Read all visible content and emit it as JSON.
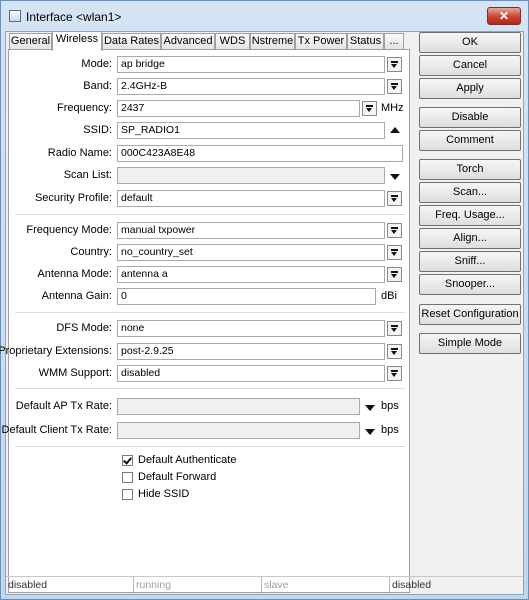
{
  "window": {
    "title": "Interface <wlan1>",
    "close_symbol": "✕"
  },
  "tabs": [
    "General",
    "Wireless",
    "Data Rates",
    "Advanced",
    "WDS",
    "Nstreme",
    "Tx Power",
    "Status",
    "..."
  ],
  "fields": {
    "mode": {
      "label": "Mode:",
      "value": "ap bridge"
    },
    "band": {
      "label": "Band:",
      "value": "2.4GHz-B"
    },
    "frequency": {
      "label": "Frequency:",
      "value": "2437",
      "unit": "MHz"
    },
    "ssid": {
      "label": "SSID:",
      "value": "SP_RADIO1"
    },
    "radio_name": {
      "label": "Radio Name:",
      "value": "000C423A8E48"
    },
    "scan_list": {
      "label": "Scan List:",
      "value": ""
    },
    "security_profile": {
      "label": "Security Profile:",
      "value": "default"
    },
    "frequency_mode": {
      "label": "Frequency Mode:",
      "value": "manual txpower"
    },
    "country": {
      "label": "Country:",
      "value": "no_country_set"
    },
    "antenna_mode": {
      "label": "Antenna Mode:",
      "value": "antenna a"
    },
    "antenna_gain": {
      "label": "Antenna Gain:",
      "value": "0",
      "unit": "dBi"
    },
    "dfs_mode": {
      "label": "DFS Mode:",
      "value": "none"
    },
    "proprietary_extensions": {
      "label": "Proprietary Extensions:",
      "value": "post-2.9.25"
    },
    "wmm_support": {
      "label": "WMM Support:",
      "value": "disabled"
    },
    "default_ap_tx_rate": {
      "label": "Default AP Tx Rate:",
      "value": "",
      "unit": "bps"
    },
    "default_client_tx_rate": {
      "label": "Default Client Tx Rate:",
      "value": "",
      "unit": "bps"
    }
  },
  "checkboxes": [
    {
      "label": "Default Authenticate",
      "checked": true
    },
    {
      "label": "Default Forward",
      "checked": false
    },
    {
      "label": "Hide SSID",
      "checked": false
    }
  ],
  "buttons": {
    "ok": "OK",
    "cancel": "Cancel",
    "apply": "Apply",
    "disable": "Disable",
    "comment": "Comment",
    "torch": "Torch",
    "scan": "Scan...",
    "freq_usage": "Freq. Usage...",
    "align": "Align...",
    "sniff": "Sniff...",
    "snooper": "Snooper...",
    "reset_configuration": "Reset Configuration",
    "simple_mode": "Simple Mode"
  },
  "status_bar": [
    "disabled",
    "running",
    "slave",
    "disabled"
  ]
}
